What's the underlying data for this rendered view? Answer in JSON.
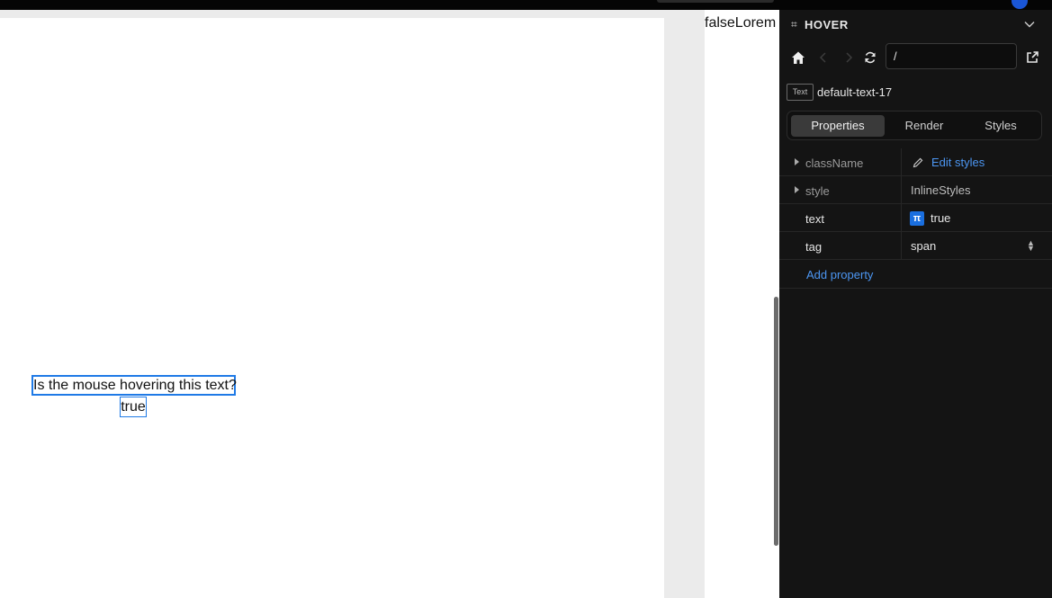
{
  "canvas": {
    "hover_question": "Is the mouse hovering this text?",
    "hover_value": "true",
    "right_page_text": "falseLorem"
  },
  "panel": {
    "title": "HOVER",
    "url_value": "/",
    "component": {
      "type_badge": "Text",
      "name": "default-text-17"
    },
    "tabs": [
      "Properties",
      "Render",
      "Styles"
    ],
    "active_tab": "Properties",
    "properties": [
      {
        "key": "className",
        "value": "Edit styles",
        "expandable": true
      },
      {
        "key": "style",
        "value": "InlineStyles",
        "expandable": true
      },
      {
        "key": "text",
        "value": "true",
        "expandable": false
      },
      {
        "key": "tag",
        "value": "span",
        "expandable": false
      }
    ],
    "add_property_label": "Add property"
  },
  "icons": {
    "home": "home-icon",
    "back": "chevron-left-icon",
    "forward": "chevron-right-icon",
    "refresh": "refresh-icon",
    "open_external": "external-link-icon",
    "collapse": "chevron-down-icon",
    "edit": "pencil-icon",
    "expression": "pi-icon"
  },
  "colors": {
    "panel_bg": "#141414",
    "accent_blue": "#1f7ae6",
    "link_blue": "#4c96f2",
    "canvas_bg": "#ebebeb"
  }
}
